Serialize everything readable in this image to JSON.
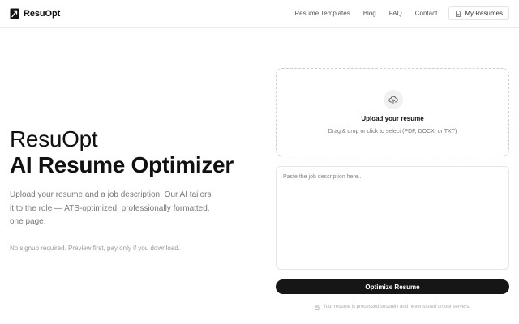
{
  "header": {
    "logo_text": "ResuOpt",
    "nav": [
      {
        "label": "Resume Templates"
      },
      {
        "label": "Blog"
      },
      {
        "label": "FAQ"
      },
      {
        "label": "Contact"
      }
    ],
    "my_resumes_label": "My Resumes"
  },
  "hero": {
    "brand": "ResuOpt",
    "title": "AI Resume Optimizer",
    "description": "Upload your resume and a job description. Our AI tailors it to the role — ATS-optimized, professionally formatted, one page.",
    "note": "No signup required. Preview first, pay only if you download."
  },
  "upload": {
    "icon": "cloud-upload-icon",
    "title": "Upload your resume",
    "subtitle": "Drag & drop or click to select (PDF, DOCX, or TXT)"
  },
  "job_description": {
    "value": "",
    "placeholder": "Paste the job description here..."
  },
  "optimize_label": "Optimize Resume",
  "secure_note": "Your resume is processed securely and never stored on our servers.",
  "colors": {
    "primary_button": "#161616",
    "text": "#111111",
    "muted": "#777777"
  }
}
